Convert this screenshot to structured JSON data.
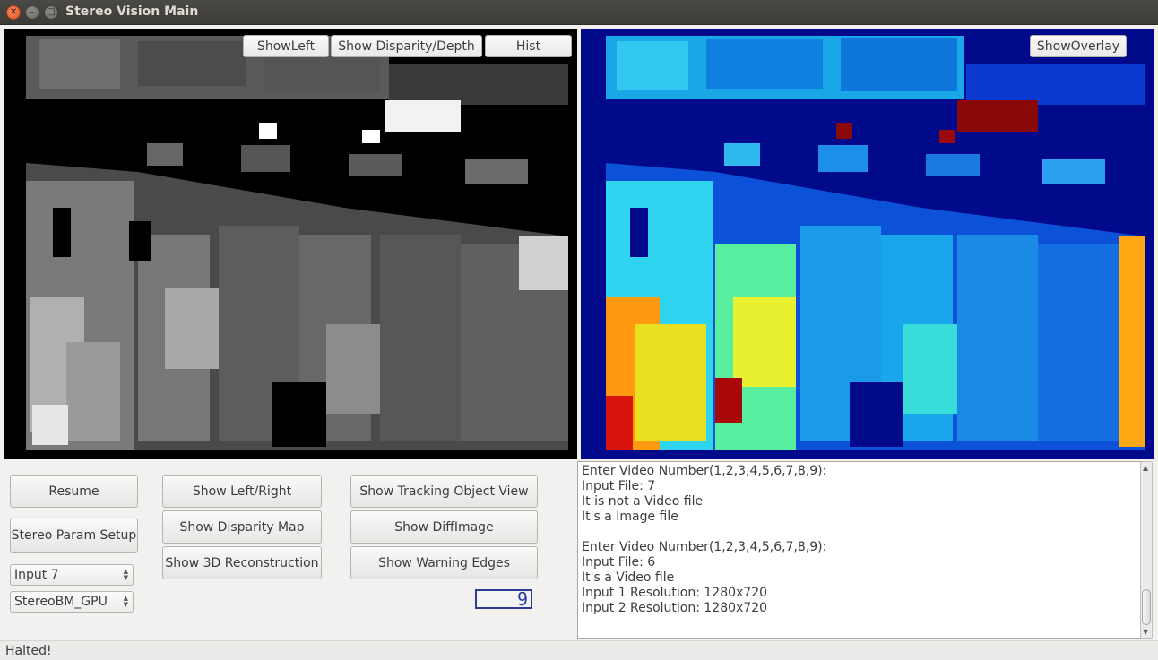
{
  "window": {
    "title": "Stereo Vision Main"
  },
  "left_view": {
    "buttons": {
      "show_left": "ShowLeft",
      "show_disparity_depth": "Show Disparity/Depth",
      "hist": "Hist"
    }
  },
  "right_view": {
    "buttons": {
      "show_overlay": "ShowOverlay"
    }
  },
  "controls": {
    "resume": "Resume",
    "stereo_param_setup": "Stereo Param Setup",
    "input_select": "Input 7",
    "algorithm_select": "StereoBM_GPU",
    "show_left_right": "Show Left/Right",
    "show_disparity_map": "Show Disparity Map",
    "show_3d_reconstruction": "Show 3D Reconstruction",
    "show_tracking_object_view": "Show Tracking Object View",
    "show_diff_image": "Show DiffImage",
    "show_warning_edges": "Show Warning Edges",
    "lcd_value": "9"
  },
  "log": {
    "lines": [
      "Enter Video Number(1,2,3,4,5,6,7,8,9):",
      "Input File: 7",
      "It is not a Video file",
      "It's a Image file",
      "",
      "Enter Video Number(1,2,3,4,5,6,7,8,9):",
      "Input File: 6",
      "It's a Video file",
      "Input 1 Resolution: 1280x720",
      "Input 2 Resolution: 1280x720"
    ]
  },
  "status": {
    "text": "Halted!"
  },
  "colors": {
    "disparity_background": "#000000",
    "depth_background": "#000a8a",
    "lcd_digits": "#2b3aa0"
  }
}
